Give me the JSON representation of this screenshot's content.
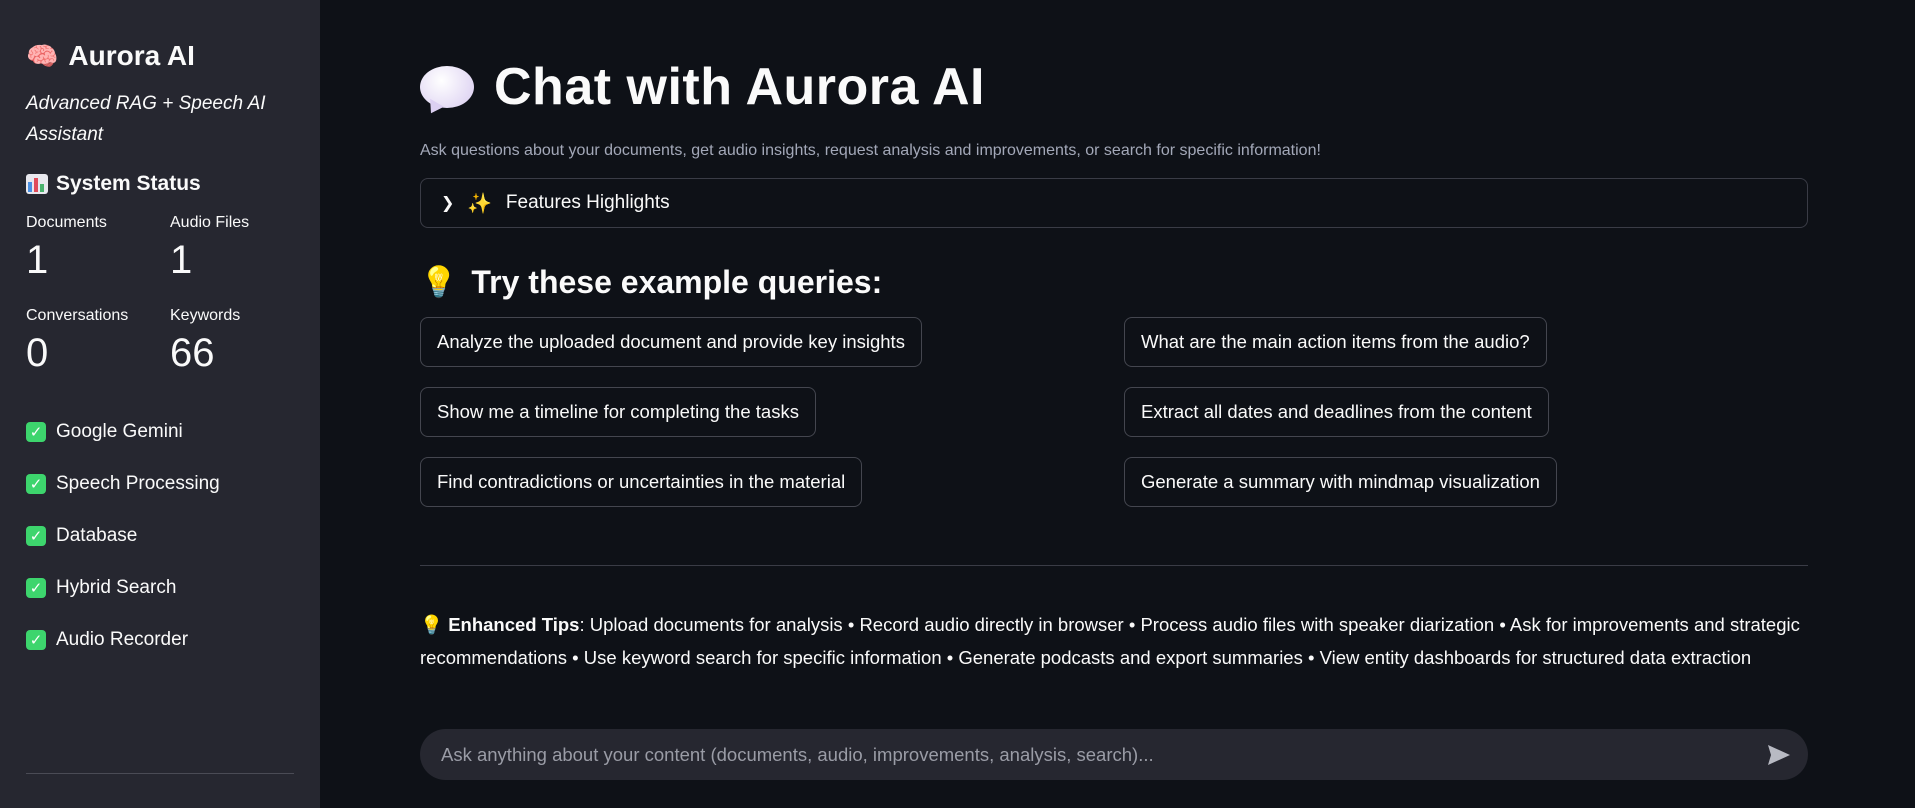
{
  "sidebar": {
    "brand_emoji": "🧠",
    "brand": "Aurora AI",
    "tagline": "Advanced RAG + Speech AI Assistant",
    "status_title": "System Status",
    "metrics": [
      {
        "label": "Documents",
        "value": "1"
      },
      {
        "label": "Audio Files",
        "value": "1"
      },
      {
        "label": "Conversations",
        "value": "0"
      },
      {
        "label": "Keywords",
        "value": "66"
      }
    ],
    "status_items": [
      {
        "label": "Google Gemini"
      },
      {
        "label": "Speech Processing"
      },
      {
        "label": "Database"
      },
      {
        "label": "Hybrid Search"
      },
      {
        "label": "Audio Recorder"
      }
    ]
  },
  "main": {
    "title": "Chat with Aurora AI",
    "subtitle": "Ask questions about your documents, get audio insights, request analysis and improvements, or search for specific information!",
    "expander_label": "Features Highlights",
    "examples_title": "Try these example queries:",
    "examples": [
      "Analyze the uploaded document and provide key insights",
      "What are the main action items from the audio?",
      "Show me a timeline for completing the tasks",
      "Extract all dates and deadlines from the content",
      "Find contradictions or uncertainties in the material",
      "Generate a summary with mindmap visualization"
    ],
    "tips_label": "Enhanced Tips",
    "tips_text": ": Upload documents for analysis • Record audio directly in browser • Process audio files with speaker diarization • Ask for improvements and strategic recommendations • Use keyword search for specific information • Generate podcasts and export summaries • View entity dashboards for structured data extraction",
    "chat_placeholder": "Ask anything about your content (documents, audio, improvements, analysis, search)..."
  },
  "colors": {
    "background": "#0e1117",
    "sidebar": "#262730",
    "check": "#3dd56d",
    "text": "#fafafa"
  }
}
